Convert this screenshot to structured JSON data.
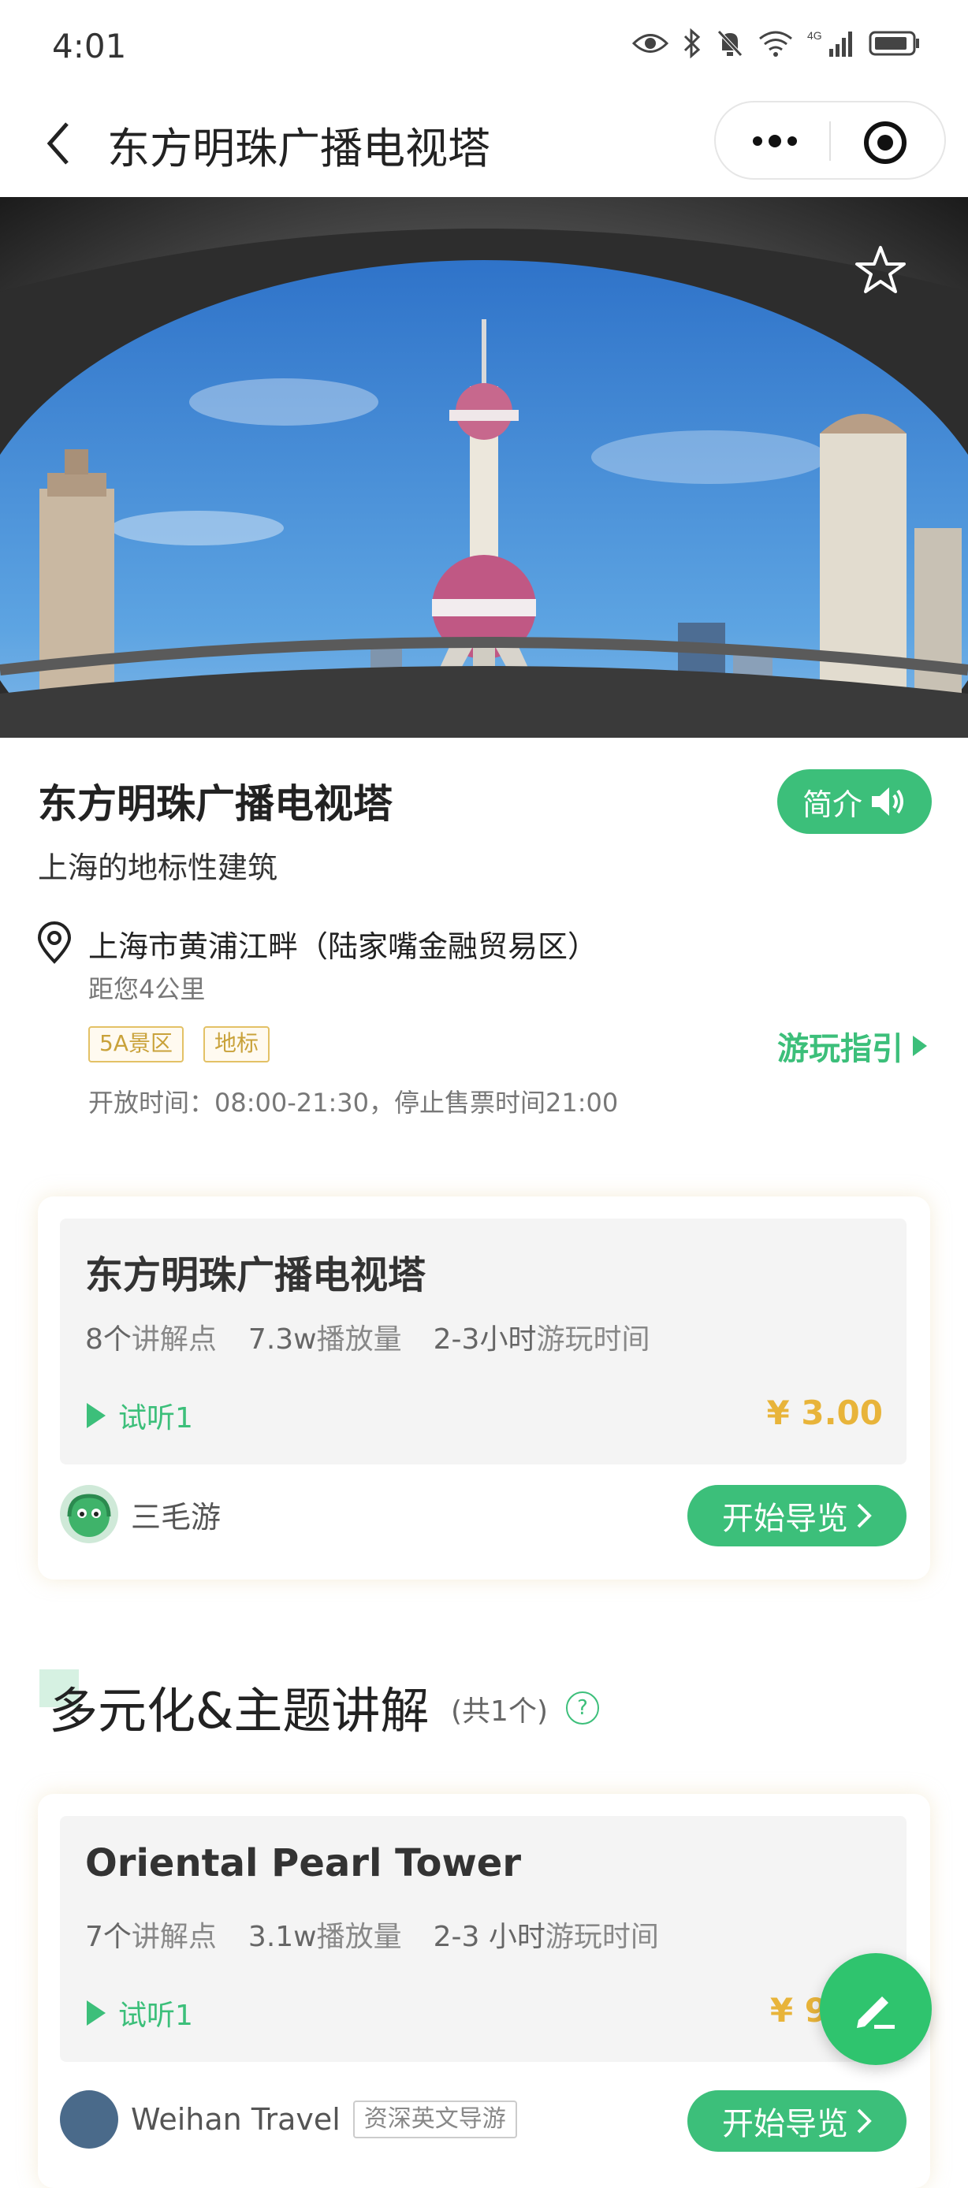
{
  "status": {
    "time": "4:01"
  },
  "nav": {
    "title": "东方明珠广播电视塔"
  },
  "poi": {
    "title": "东方明珠广播电视塔",
    "intro_btn": "简介",
    "subtitle": "上海的地标性建筑",
    "address": "上海市黄浦江畔（陆家嘴金融贸易区）",
    "distance": "距您4公里",
    "tags": [
      "5A景区",
      "地标"
    ],
    "guide_link": "游玩指引",
    "hours": "开放时间：08:00-21:30，停止售票时间21:00"
  },
  "card1": {
    "title": "东方明珠广播电视塔",
    "stats": [
      {
        "num": "8个",
        "label": "讲解点"
      },
      {
        "num": "7.3w",
        "label": "播放量"
      },
      {
        "num": "2-3小时",
        "label": "游玩时间"
      }
    ],
    "trial": "试听1",
    "price": "¥ 3.00",
    "author": "三毛游",
    "start": "开始导览"
  },
  "section": {
    "title": "多元化&主题讲解",
    "count": "(共1个)",
    "help": "?"
  },
  "card2": {
    "title": "Oriental Pearl Tower",
    "stats": [
      {
        "num": "7个",
        "label": "讲解点"
      },
      {
        "num": "3.1w",
        "label": "播放量"
      },
      {
        "num": "2-3 小时",
        "label": "游玩时间"
      }
    ],
    "trial": "试听1",
    "price": "¥ 9",
    "author": "Weihan Travel",
    "author_tag": "资深英文导游",
    "start": "开始导览"
  },
  "icons": [
    "eye-icon",
    "bluetooth-icon",
    "mute-bell-icon",
    "wifi-icon",
    "signal-icon",
    "battery-icon",
    "back-icon",
    "more-icon",
    "target-icon",
    "star-icon",
    "location-pin-icon",
    "speaker-icon",
    "play-icon",
    "edit-icon"
  ],
  "colors": {
    "accent": "#3cbf7a",
    "price": "#e8b43a",
    "tag": "#c9a23a"
  }
}
